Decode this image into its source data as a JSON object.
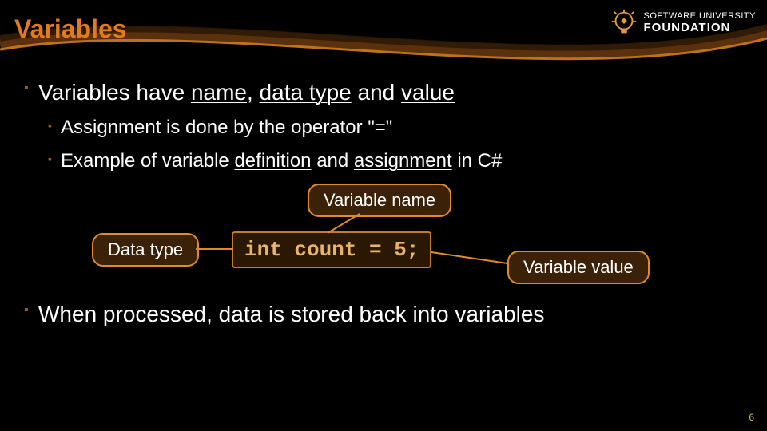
{
  "title": "Variables",
  "logo": {
    "line1": "SOFTWARE UNIVERSITY",
    "line2": "FOUNDATION"
  },
  "bullets": {
    "b1": {
      "pre": "Variables have ",
      "u1": "name",
      "sep1": ", ",
      "u2": "data type",
      "mid": " and ",
      "u3": "value"
    },
    "b2a": "Assignment is done by the operator \"=\"",
    "b2b": {
      "pre": "Example of variable ",
      "u1": "definition",
      "mid": " and ",
      "u2": "assignment",
      "post": " in C#"
    },
    "b1last": "When processed, data is stored back into variables"
  },
  "diagram": {
    "name_label": "Variable name",
    "type_label": "Data type",
    "value_label": "Variable value",
    "code": "int count = 5;"
  },
  "page": "6"
}
